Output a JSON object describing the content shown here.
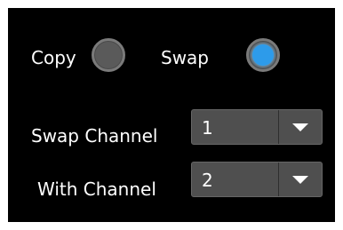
{
  "mode": {
    "copy_label": "Copy",
    "swap_label": "Swap",
    "selected": "Swap"
  },
  "swap_channel": {
    "label": "Swap Channel",
    "value": "1"
  },
  "with_channel": {
    "label": "With Channel",
    "value": "2"
  },
  "colors": {
    "background": "#000000",
    "radio_selected": "#2d9bea",
    "control": "#4f4f4f",
    "text": "#ffffff"
  },
  "icons": {
    "dropdown": "chevron-down-icon"
  }
}
